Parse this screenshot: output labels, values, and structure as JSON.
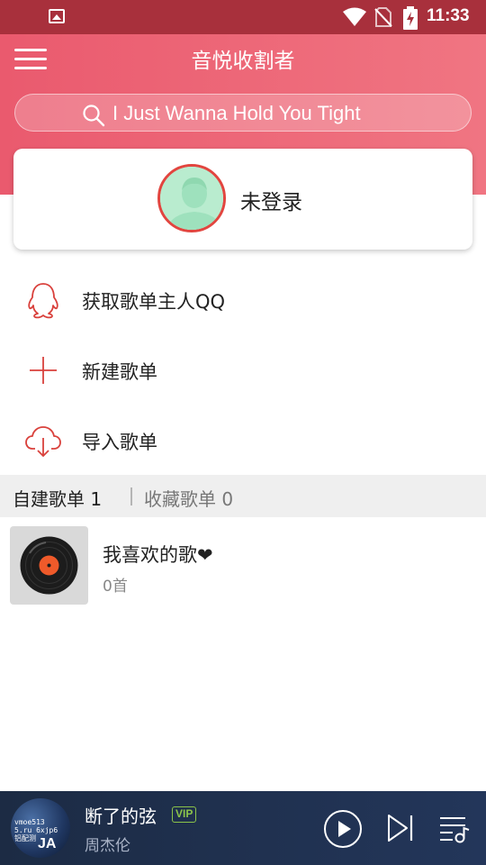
{
  "status_bar": {
    "time": "11:33"
  },
  "header": {
    "title": "音悦收割者",
    "search_text": "I Just Wanna Hold You Tight"
  },
  "user": {
    "login_status": "未登录"
  },
  "actions": [
    {
      "label": "获取歌单主人QQ",
      "icon": "qq-penguin-icon"
    },
    {
      "label": "新建歌单",
      "icon": "plus-icon"
    },
    {
      "label": "导入歌单",
      "icon": "cloud-download-icon"
    }
  ],
  "tabs": {
    "created": "自建歌单 1",
    "collected": "收藏歌单 0"
  },
  "playlists": [
    {
      "name": "我喜欢的歌❤",
      "count": "0首"
    }
  ],
  "player": {
    "song": "断了的弦",
    "badge": "VIP",
    "artist": "周杰伦",
    "album_art_text": [
      "vmoe513",
      "5.ru 6xjp6",
      "铝配测"
    ],
    "album_art_mark": "JA"
  },
  "colors": {
    "accent": "#ea5a6e",
    "status_bar": "#a8303c",
    "icon_red": "#d9413c",
    "player_bg": "#1c2b44",
    "vip_green": "#8bc34a"
  }
}
